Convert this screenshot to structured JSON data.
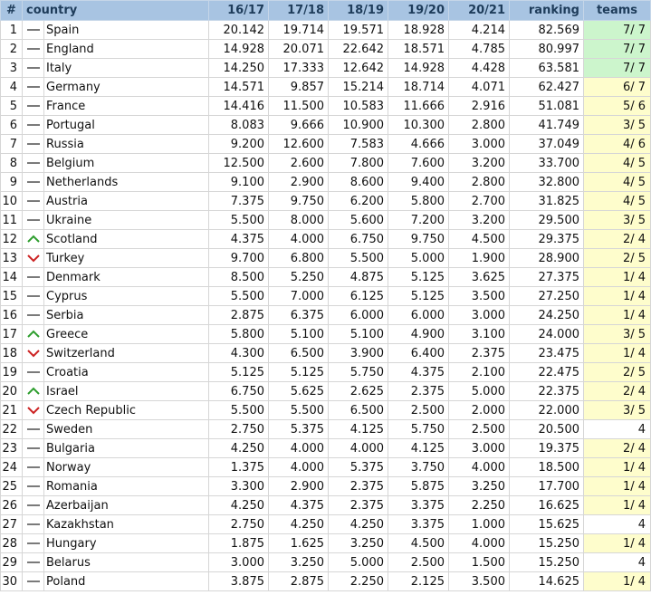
{
  "headers": [
    "#",
    "country",
    "16/17",
    "17/18",
    "18/19",
    "19/20",
    "20/21",
    "ranking",
    "teams"
  ],
  "colors": {
    "header_bg": "#a8c4e2",
    "teams_green": "#ccf5cc",
    "teams_yellow": "#fefdcc",
    "up": "#2e9e2e",
    "down": "#cc2222",
    "same": "#7a7a7a"
  },
  "rows": [
    {
      "rank": "1",
      "trend": "same",
      "country": "Spain",
      "s1": "20.142",
      "s2": "19.714",
      "s3": "19.571",
      "s4": "18.928",
      "s5": "4.214",
      "ranking": "82.569",
      "teams": "7/ 7",
      "teams_bg": "green"
    },
    {
      "rank": "2",
      "trend": "same",
      "country": "England",
      "s1": "14.928",
      "s2": "20.071",
      "s3": "22.642",
      "s4": "18.571",
      "s5": "4.785",
      "ranking": "80.997",
      "teams": "7/ 7",
      "teams_bg": "green"
    },
    {
      "rank": "3",
      "trend": "same",
      "country": "Italy",
      "s1": "14.250",
      "s2": "17.333",
      "s3": "12.642",
      "s4": "14.928",
      "s5": "4.428",
      "ranking": "63.581",
      "teams": "7/ 7",
      "teams_bg": "green"
    },
    {
      "rank": "4",
      "trend": "same",
      "country": "Germany",
      "s1": "14.571",
      "s2": "9.857",
      "s3": "15.214",
      "s4": "18.714",
      "s5": "4.071",
      "ranking": "62.427",
      "teams": "6/ 7",
      "teams_bg": "yellow"
    },
    {
      "rank": "5",
      "trend": "same",
      "country": "France",
      "s1": "14.416",
      "s2": "11.500",
      "s3": "10.583",
      "s4": "11.666",
      "s5": "2.916",
      "ranking": "51.081",
      "teams": "5/ 6",
      "teams_bg": "yellow"
    },
    {
      "rank": "6",
      "trend": "same",
      "country": "Portugal",
      "s1": "8.083",
      "s2": "9.666",
      "s3": "10.900",
      "s4": "10.300",
      "s5": "2.800",
      "ranking": "41.749",
      "teams": "3/ 5",
      "teams_bg": "yellow"
    },
    {
      "rank": "7",
      "trend": "same",
      "country": "Russia",
      "s1": "9.200",
      "s2": "12.600",
      "s3": "7.583",
      "s4": "4.666",
      "s5": "3.000",
      "ranking": "37.049",
      "teams": "4/ 6",
      "teams_bg": "yellow"
    },
    {
      "rank": "8",
      "trend": "same",
      "country": "Belgium",
      "s1": "12.500",
      "s2": "2.600",
      "s3": "7.800",
      "s4": "7.600",
      "s5": "3.200",
      "ranking": "33.700",
      "teams": "4/ 5",
      "teams_bg": "yellow"
    },
    {
      "rank": "9",
      "trend": "same",
      "country": "Netherlands",
      "s1": "9.100",
      "s2": "2.900",
      "s3": "8.600",
      "s4": "9.400",
      "s5": "2.800",
      "ranking": "32.800",
      "teams": "4/ 5",
      "teams_bg": "yellow"
    },
    {
      "rank": "10",
      "trend": "same",
      "country": "Austria",
      "s1": "7.375",
      "s2": "9.750",
      "s3": "6.200",
      "s4": "5.800",
      "s5": "2.700",
      "ranking": "31.825",
      "teams": "4/ 5",
      "teams_bg": "yellow"
    },
    {
      "rank": "11",
      "trend": "same",
      "country": "Ukraine",
      "s1": "5.500",
      "s2": "8.000",
      "s3": "5.600",
      "s4": "7.200",
      "s5": "3.200",
      "ranking": "29.500",
      "teams": "3/ 5",
      "teams_bg": "yellow"
    },
    {
      "rank": "12",
      "trend": "up",
      "country": "Scotland",
      "s1": "4.375",
      "s2": "4.000",
      "s3": "6.750",
      "s4": "9.750",
      "s5": "4.500",
      "ranking": "29.375",
      "teams": "2/ 4",
      "teams_bg": "yellow"
    },
    {
      "rank": "13",
      "trend": "down",
      "country": "Turkey",
      "s1": "9.700",
      "s2": "6.800",
      "s3": "5.500",
      "s4": "5.000",
      "s5": "1.900",
      "ranking": "28.900",
      "teams": "2/ 5",
      "teams_bg": "yellow"
    },
    {
      "rank": "14",
      "trend": "same",
      "country": "Denmark",
      "s1": "8.500",
      "s2": "5.250",
      "s3": "4.875",
      "s4": "5.125",
      "s5": "3.625",
      "ranking": "27.375",
      "teams": "1/ 4",
      "teams_bg": "yellow"
    },
    {
      "rank": "15",
      "trend": "same",
      "country": "Cyprus",
      "s1": "5.500",
      "s2": "7.000",
      "s3": "6.125",
      "s4": "5.125",
      "s5": "3.500",
      "ranking": "27.250",
      "teams": "1/ 4",
      "teams_bg": "yellow"
    },
    {
      "rank": "16",
      "trend": "same",
      "country": "Serbia",
      "s1": "2.875",
      "s2": "6.375",
      "s3": "6.000",
      "s4": "6.000",
      "s5": "3.000",
      "ranking": "24.250",
      "teams": "1/ 4",
      "teams_bg": "yellow"
    },
    {
      "rank": "17",
      "trend": "up",
      "country": "Greece",
      "s1": "5.800",
      "s2": "5.100",
      "s3": "5.100",
      "s4": "4.900",
      "s5": "3.100",
      "ranking": "24.000",
      "teams": "3/ 5",
      "teams_bg": "yellow"
    },
    {
      "rank": "18",
      "trend": "down",
      "country": "Switzerland",
      "s1": "4.300",
      "s2": "6.500",
      "s3": "3.900",
      "s4": "6.400",
      "s5": "2.375",
      "ranking": "23.475",
      "teams": "1/ 4",
      "teams_bg": "yellow"
    },
    {
      "rank": "19",
      "trend": "same",
      "country": "Croatia",
      "s1": "5.125",
      "s2": "5.125",
      "s3": "5.750",
      "s4": "4.375",
      "s5": "2.100",
      "ranking": "22.475",
      "teams": "2/ 5",
      "teams_bg": "yellow"
    },
    {
      "rank": "20",
      "trend": "up",
      "country": "Israel",
      "s1": "6.750",
      "s2": "5.625",
      "s3": "2.625",
      "s4": "2.375",
      "s5": "5.000",
      "ranking": "22.375",
      "teams": "2/ 4",
      "teams_bg": "yellow"
    },
    {
      "rank": "21",
      "trend": "down",
      "country": "Czech Republic",
      "s1": "5.500",
      "s2": "5.500",
      "s3": "6.500",
      "s4": "2.500",
      "s5": "2.000",
      "ranking": "22.000",
      "teams": "3/ 5",
      "teams_bg": "yellow"
    },
    {
      "rank": "22",
      "trend": "same",
      "country": "Sweden",
      "s1": "2.750",
      "s2": "5.375",
      "s3": "4.125",
      "s4": "5.750",
      "s5": "2.500",
      "ranking": "20.500",
      "teams": "4",
      "teams_bg": "none"
    },
    {
      "rank": "23",
      "trend": "same",
      "country": "Bulgaria",
      "s1": "4.250",
      "s2": "4.000",
      "s3": "4.000",
      "s4": "4.125",
      "s5": "3.000",
      "ranking": "19.375",
      "teams": "2/ 4",
      "teams_bg": "yellow"
    },
    {
      "rank": "24",
      "trend": "same",
      "country": "Norway",
      "s1": "1.375",
      "s2": "4.000",
      "s3": "5.375",
      "s4": "3.750",
      "s5": "4.000",
      "ranking": "18.500",
      "teams": "1/ 4",
      "teams_bg": "yellow"
    },
    {
      "rank": "25",
      "trend": "same",
      "country": "Romania",
      "s1": "3.300",
      "s2": "2.900",
      "s3": "2.375",
      "s4": "5.875",
      "s5": "3.250",
      "ranking": "17.700",
      "teams": "1/ 4",
      "teams_bg": "yellow"
    },
    {
      "rank": "26",
      "trend": "same",
      "country": "Azerbaijan",
      "s1": "4.250",
      "s2": "4.375",
      "s3": "2.375",
      "s4": "3.375",
      "s5": "2.250",
      "ranking": "16.625",
      "teams": "1/ 4",
      "teams_bg": "yellow"
    },
    {
      "rank": "27",
      "trend": "same",
      "country": "Kazakhstan",
      "s1": "2.750",
      "s2": "4.250",
      "s3": "4.250",
      "s4": "3.375",
      "s5": "1.000",
      "ranking": "15.625",
      "teams": "4",
      "teams_bg": "none"
    },
    {
      "rank": "28",
      "trend": "same",
      "country": "Hungary",
      "s1": "1.875",
      "s2": "1.625",
      "s3": "3.250",
      "s4": "4.500",
      "s5": "4.000",
      "ranking": "15.250",
      "teams": "1/ 4",
      "teams_bg": "yellow"
    },
    {
      "rank": "29",
      "trend": "same",
      "country": "Belarus",
      "s1": "3.000",
      "s2": "3.250",
      "s3": "5.000",
      "s4": "2.500",
      "s5": "1.500",
      "ranking": "15.250",
      "teams": "4",
      "teams_bg": "none"
    },
    {
      "rank": "30",
      "trend": "same",
      "country": "Poland",
      "s1": "3.875",
      "s2": "2.875",
      "s3": "2.250",
      "s4": "2.125",
      "s5": "3.500",
      "ranking": "14.625",
      "teams": "1/ 4",
      "teams_bg": "yellow"
    }
  ]
}
